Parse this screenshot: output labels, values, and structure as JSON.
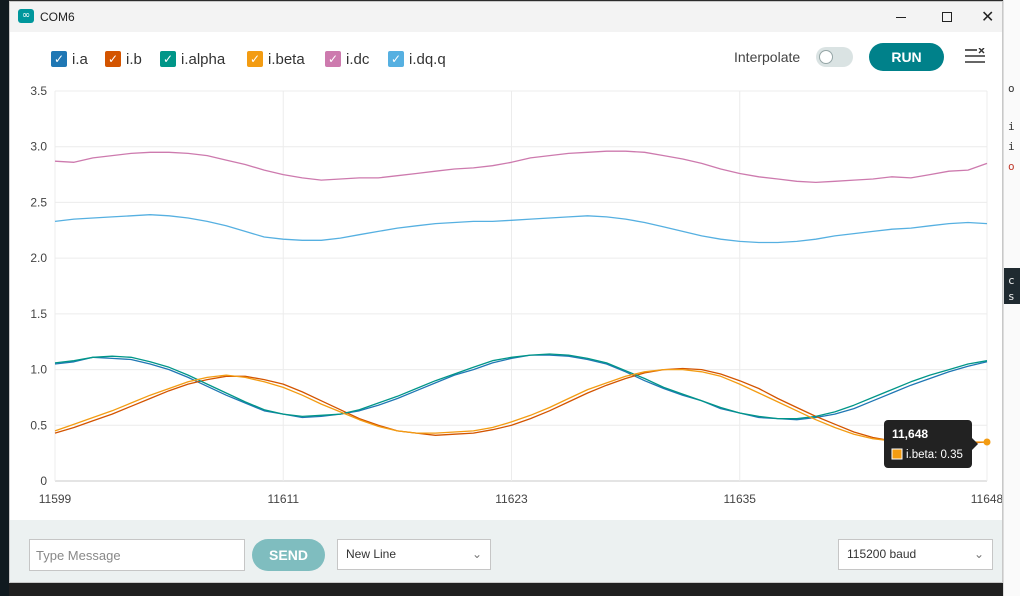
{
  "window": {
    "title": "COM6",
    "app_icon": "arduino-infinity-icon",
    "controls": [
      "minimize",
      "maximize",
      "close"
    ]
  },
  "legend": [
    {
      "label": "i.a",
      "color": "#1f77b4",
      "checked": true
    },
    {
      "label": "i.b",
      "color": "#d35400",
      "checked": true
    },
    {
      "label": "i.alpha",
      "color": "#009688",
      "checked": true
    },
    {
      "label": "i.beta",
      "color": "#f39c12",
      "checked": true
    },
    {
      "label": "i.dc",
      "color": "#cd7aae",
      "checked": true
    },
    {
      "label": "i.dq.q",
      "color": "#56b0e1",
      "checked": true
    }
  ],
  "toolbar": {
    "interpolate_label": "Interpolate",
    "interpolate_on": false,
    "run_label": "RUN"
  },
  "chart_data": {
    "type": "line",
    "xlim": [
      11599,
      11648
    ],
    "ylim": [
      0,
      3.5
    ],
    "x_ticks": [
      "11599",
      "11611",
      "11623",
      "11635",
      "11648"
    ],
    "y_ticks": [
      "0",
      "0.5",
      "1.0",
      "1.5",
      "2.0",
      "2.5",
      "3.0",
      "3.5"
    ],
    "x": [
      11599,
      11600,
      11601,
      11602,
      11603,
      11604,
      11605,
      11606,
      11607,
      11608,
      11609,
      11610,
      11611,
      11612,
      11613,
      11614,
      11615,
      11616,
      11617,
      11618,
      11619,
      11620,
      11621,
      11622,
      11623,
      11624,
      11625,
      11626,
      11627,
      11628,
      11629,
      11630,
      11631,
      11632,
      11633,
      11634,
      11635,
      11636,
      11637,
      11638,
      11639,
      11640,
      11641,
      11642,
      11643,
      11644,
      11645,
      11646,
      11647,
      11648
    ],
    "series": [
      {
        "name": "i.a",
        "color": "#1f77b4",
        "values": [
          1.05,
          1.07,
          1.11,
          1.1,
          1.09,
          1.05,
          1.0,
          0.93,
          0.85,
          0.77,
          0.7,
          0.63,
          0.6,
          0.57,
          0.58,
          0.6,
          0.63,
          0.68,
          0.74,
          0.81,
          0.88,
          0.95,
          1.0,
          1.06,
          1.1,
          1.13,
          1.13,
          1.12,
          1.09,
          1.05,
          0.98,
          0.9,
          0.83,
          0.77,
          0.72,
          0.65,
          0.61,
          0.57,
          0.56,
          0.55,
          0.57,
          0.6,
          0.65,
          0.72,
          0.79,
          0.86,
          0.92,
          0.98,
          1.03,
          1.07
        ]
      },
      {
        "name": "i.b",
        "color": "#d35400",
        "values": [
          0.43,
          0.48,
          0.54,
          0.6,
          0.67,
          0.74,
          0.81,
          0.87,
          0.91,
          0.94,
          0.94,
          0.91,
          0.87,
          0.8,
          0.72,
          0.64,
          0.56,
          0.5,
          0.45,
          0.43,
          0.41,
          0.42,
          0.43,
          0.46,
          0.5,
          0.56,
          0.63,
          0.71,
          0.79,
          0.86,
          0.92,
          0.97,
          1.0,
          1.01,
          1.0,
          0.96,
          0.9,
          0.83,
          0.74,
          0.66,
          0.58,
          0.51,
          0.44,
          0.39,
          0.36,
          0.34,
          0.33,
          0.34,
          0.34,
          0.35
        ]
      },
      {
        "name": "i.alpha",
        "color": "#009688",
        "values": [
          1.06,
          1.08,
          1.11,
          1.12,
          1.11,
          1.07,
          1.02,
          0.95,
          0.87,
          0.79,
          0.71,
          0.64,
          0.6,
          0.58,
          0.59,
          0.6,
          0.64,
          0.7,
          0.76,
          0.83,
          0.9,
          0.96,
          1.02,
          1.08,
          1.11,
          1.13,
          1.14,
          1.13,
          1.1,
          1.06,
          0.99,
          0.92,
          0.84,
          0.78,
          0.72,
          0.66,
          0.61,
          0.58,
          0.56,
          0.56,
          0.58,
          0.62,
          0.68,
          0.75,
          0.82,
          0.89,
          0.95,
          1.0,
          1.05,
          1.08
        ]
      },
      {
        "name": "i.beta",
        "color": "#f39c12",
        "values": [
          0.45,
          0.51,
          0.57,
          0.63,
          0.7,
          0.77,
          0.83,
          0.89,
          0.93,
          0.95,
          0.93,
          0.89,
          0.84,
          0.77,
          0.69,
          0.62,
          0.55,
          0.49,
          0.45,
          0.43,
          0.43,
          0.44,
          0.45,
          0.48,
          0.53,
          0.59,
          0.66,
          0.74,
          0.82,
          0.88,
          0.94,
          0.98,
          1.0,
          1.0,
          0.98,
          0.94,
          0.87,
          0.79,
          0.71,
          0.63,
          0.55,
          0.48,
          0.42,
          0.38,
          0.36,
          0.35,
          0.34,
          0.35,
          0.35,
          0.35
        ]
      },
      {
        "name": "i.dc",
        "color": "#cd7aae",
        "values": [
          2.87,
          2.86,
          2.9,
          2.92,
          2.94,
          2.95,
          2.95,
          2.94,
          2.92,
          2.88,
          2.84,
          2.79,
          2.75,
          2.72,
          2.7,
          2.71,
          2.72,
          2.72,
          2.74,
          2.76,
          2.78,
          2.8,
          2.81,
          2.83,
          2.86,
          2.9,
          2.92,
          2.94,
          2.95,
          2.96,
          2.96,
          2.95,
          2.92,
          2.89,
          2.85,
          2.8,
          2.76,
          2.73,
          2.71,
          2.69,
          2.68,
          2.69,
          2.7,
          2.71,
          2.73,
          2.72,
          2.75,
          2.78,
          2.79,
          2.85
        ]
      },
      {
        "name": "i.dq.q",
        "color": "#56b0e1",
        "values": [
          2.33,
          2.35,
          2.36,
          2.37,
          2.38,
          2.39,
          2.38,
          2.36,
          2.33,
          2.29,
          2.24,
          2.19,
          2.17,
          2.16,
          2.16,
          2.18,
          2.21,
          2.24,
          2.27,
          2.29,
          2.31,
          2.32,
          2.33,
          2.33,
          2.34,
          2.35,
          2.36,
          2.37,
          2.38,
          2.37,
          2.35,
          2.32,
          2.28,
          2.24,
          2.2,
          2.17,
          2.15,
          2.14,
          2.14,
          2.15,
          2.17,
          2.2,
          2.22,
          2.24,
          2.26,
          2.27,
          2.29,
          2.31,
          2.32,
          2.31
        ]
      }
    ],
    "tooltip": {
      "title": "11,648",
      "text": "i.beta: 0.35",
      "color": "#f39c12"
    }
  },
  "bottom": {
    "message_placeholder": "Type Message",
    "send_label": "SEND",
    "line_ending": "New Line",
    "baud": "115200 baud"
  },
  "background_fragments": [
    "o",
    "i",
    "i",
    "o",
    "c",
    "s"
  ]
}
